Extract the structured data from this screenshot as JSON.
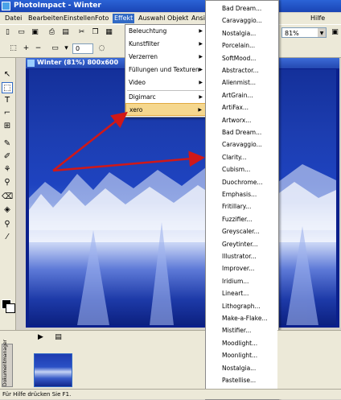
{
  "window": {
    "title": "PhotoImpact - Winter"
  },
  "menubar": {
    "items": [
      "Datei",
      "Bearbeiten",
      "Einstellen",
      "Foto",
      "Effekt",
      "Auswahl",
      "Objekt",
      "Ansic",
      "Hilfe"
    ]
  },
  "toolbar": {
    "zoom_value": "81%",
    "stepper_value": "0"
  },
  "document": {
    "title": "Winter (81%) 800x600"
  },
  "effekt_menu": {
    "items": [
      {
        "label": "Beleuchtung"
      },
      {
        "label": "Kunstfilter"
      },
      {
        "label": "Verzerren"
      },
      {
        "label": "Füllungen und Texturen"
      },
      {
        "label": "Video"
      },
      {
        "label": "Digimarc"
      },
      {
        "label": "xero"
      }
    ]
  },
  "xero_menu": {
    "items": [
      "Bad Dream...",
      "Caravaggio...",
      "Nostalgia...",
      "Porcelain...",
      "SoftMood...",
      "Abstractor...",
      "Alienmist...",
      "ArtGrain...",
      "ArtiFax...",
      "Artworx...",
      "Bad Dream...",
      "Caravaggio...",
      "Clarity...",
      "Cubism...",
      "Duochrome...",
      "Emphasis...",
      "Fritillary...",
      "Fuzzifier...",
      "Greyscaler...",
      "Greytinter...",
      "Illustrator...",
      "Improver...",
      "Iridium...",
      "Lineart...",
      "Lithograph...",
      "Make-a-Flake...",
      "Mistifier...",
      "Moodlight...",
      "Moonlight...",
      "Nostalgia...",
      "Pastellise..."
    ]
  },
  "document_manager": {
    "tab_label": "Dokumentmanager"
  },
  "status": {
    "text": "Für Hilfe drücken Sie F1."
  },
  "colors": {
    "arrow": "#d01818",
    "menu_highlight": "#f5d78e",
    "title_bar": "#1a45b5"
  }
}
